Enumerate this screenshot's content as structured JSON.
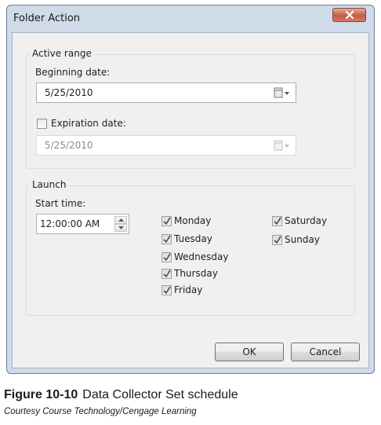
{
  "window": {
    "title": "Folder Action"
  },
  "active_range": {
    "group_label": "Active range",
    "beginning_label": "Beginning date:",
    "beginning_value": "5/25/2010",
    "expiration_label": "Expiration date:",
    "expiration_checked": false,
    "expiration_value": "5/25/2010"
  },
  "launch": {
    "group_label": "Launch",
    "start_time_label": "Start time:",
    "start_time_value": "12:00:00 AM",
    "days": [
      {
        "label": "Monday",
        "checked": true
      },
      {
        "label": "Tuesday",
        "checked": true
      },
      {
        "label": "Wednesday",
        "checked": true
      },
      {
        "label": "Thursday",
        "checked": true
      },
      {
        "label": "Friday",
        "checked": true
      },
      {
        "label": "Saturday",
        "checked": true
      },
      {
        "label": "Sunday",
        "checked": true
      }
    ]
  },
  "buttons": {
    "ok": "OK",
    "cancel": "Cancel"
  },
  "caption": {
    "figure": "Figure 10-10",
    "text": "Data Collector Set schedule",
    "credit": "Courtesy Course Technology/Cengage Learning"
  },
  "icons": {
    "close": "close-icon",
    "calendar": "calendar-icon",
    "check": "check-icon",
    "spin_up": "spin-up-icon",
    "spin_down": "spin-down-icon"
  }
}
